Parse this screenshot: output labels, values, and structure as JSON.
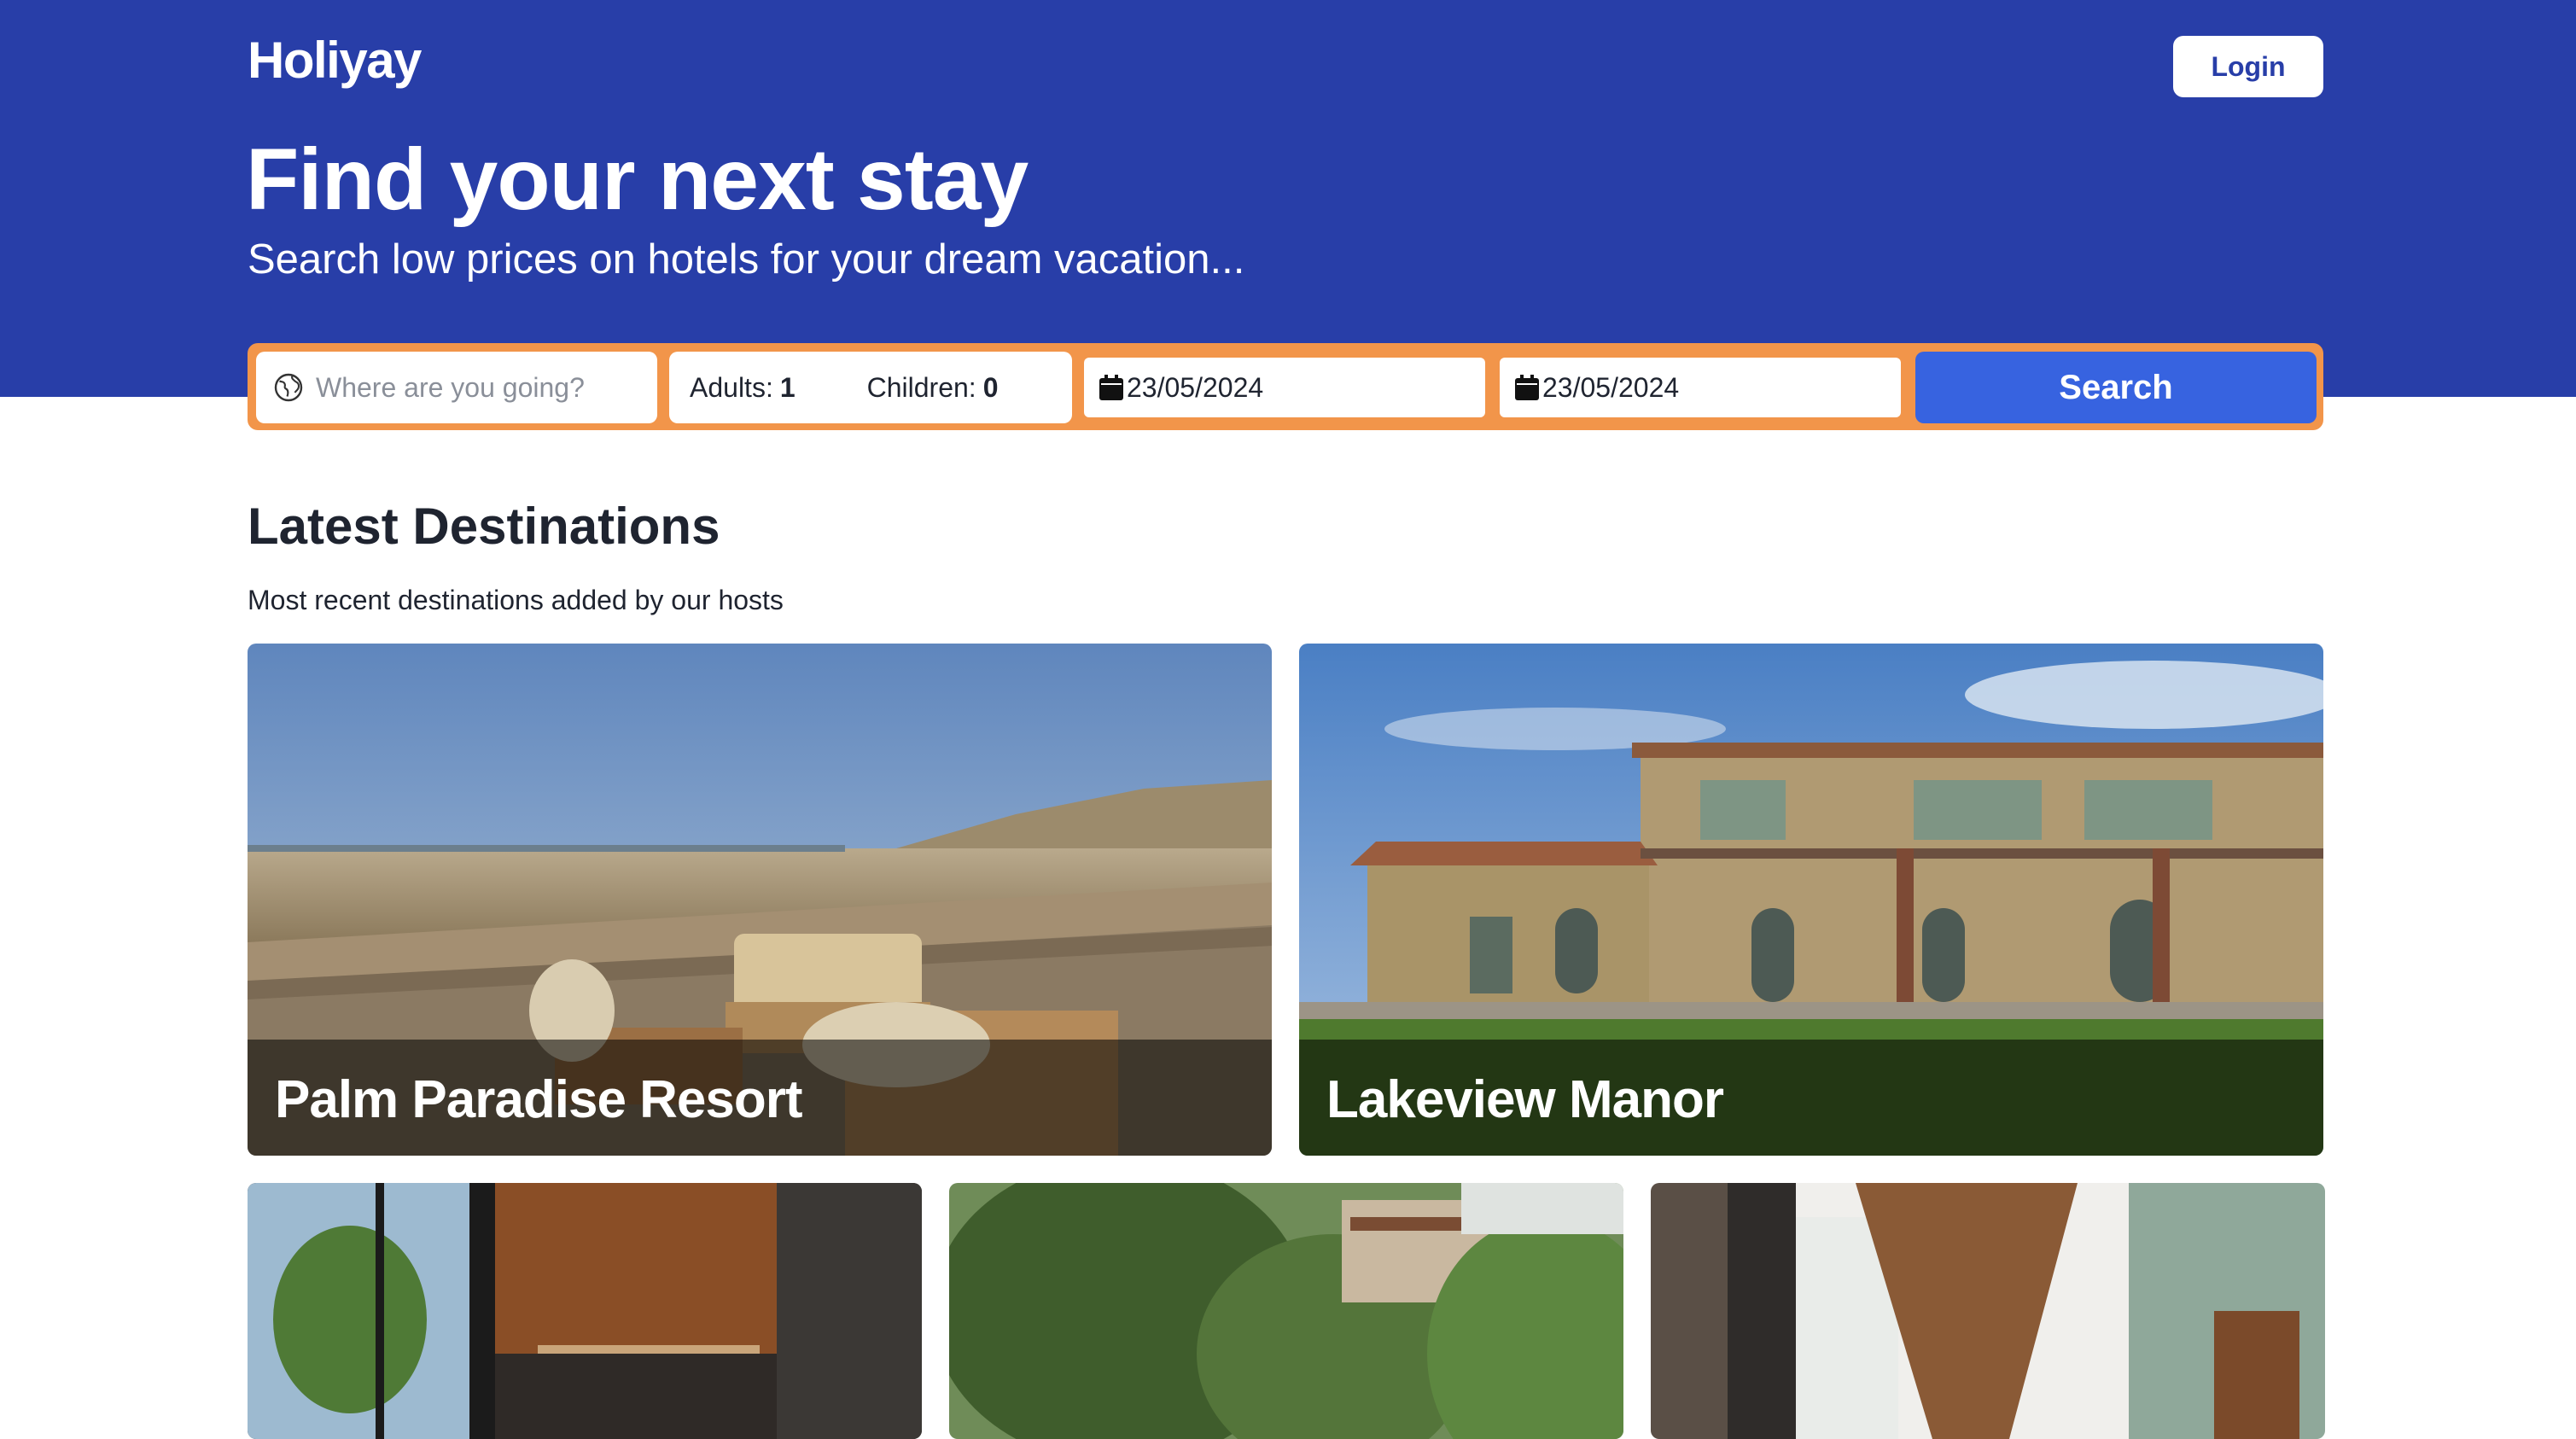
{
  "header": {
    "brand": "Holiyay",
    "login_label": "Login"
  },
  "hero": {
    "headline": "Find your next stay",
    "subheadline": "Search low prices on hotels for your dream vacation..."
  },
  "search": {
    "destination_placeholder": "Where are you going?",
    "destination_icon": "globe-icon",
    "adults_label": "Adults:",
    "adults_value": "1",
    "children_label": "Children:",
    "children_value": "0",
    "check_in": "23/05/2024",
    "check_out": "23/05/2024",
    "date_icon": "calendar-icon",
    "button_label": "Search"
  },
  "latest": {
    "title": "Latest Destinations",
    "subtitle": "Most recent destinations added by our hosts",
    "featured": [
      {
        "name": "Palm Paradise Resort"
      },
      {
        "name": "Lakeview Manor"
      }
    ]
  },
  "colors": {
    "hero_bg": "#283ea8",
    "search_bar_border": "#f2954a",
    "search_button": "#3763e0",
    "text_dark": "#1f2430"
  }
}
